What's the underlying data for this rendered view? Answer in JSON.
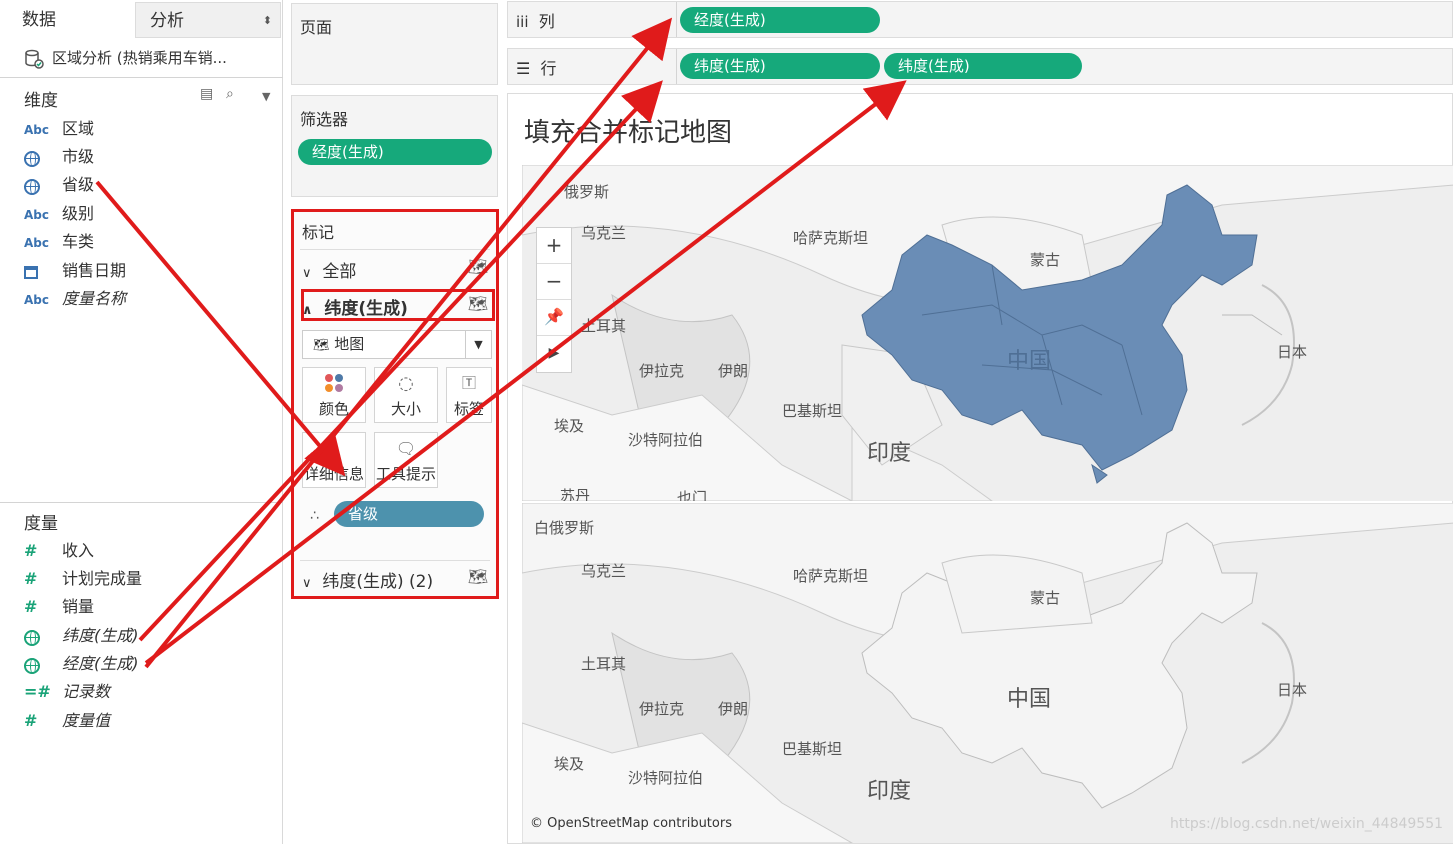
{
  "left_pane": {
    "tabs": {
      "data": "数据",
      "analysis": "分析"
    },
    "datasource": "区域分析 (热销乘用车销...",
    "dimensions_title": "维度",
    "dimensions": [
      {
        "type": "Abc",
        "label": "区域"
      },
      {
        "type": "globe",
        "label": "市级"
      },
      {
        "type": "globe",
        "label": "省级"
      },
      {
        "type": "Abc",
        "label": "级别"
      },
      {
        "type": "Abc",
        "label": "车类"
      },
      {
        "type": "calendar",
        "label": "销售日期"
      },
      {
        "type": "Abc",
        "label": "度量名称"
      }
    ],
    "measures_title": "度量",
    "measures": [
      {
        "type": "#",
        "label": "收入"
      },
      {
        "type": "#",
        "label": "计划完成量"
      },
      {
        "type": "#",
        "label": "销量"
      },
      {
        "type": "globe",
        "label": "纬度(生成)"
      },
      {
        "type": "globe",
        "label": "经度(生成)"
      },
      {
        "type": "=#",
        "label": "记录数"
      },
      {
        "type": "#",
        "label": "度量值"
      }
    ]
  },
  "pages_card": {
    "title": "页面"
  },
  "filters_card": {
    "title": "筛选器",
    "pill": "经度(生成)"
  },
  "marks_card": {
    "title": "标记",
    "all": "全部",
    "lat": "纬度(生成)",
    "mark_type": "地图",
    "buttons": {
      "color": "颜色",
      "size": "大小",
      "label": "标签",
      "detail": "详细信息",
      "tooltip": "工具提示"
    },
    "detail_pill": "省级",
    "lat2": "纬度(生成) (2)"
  },
  "shelves": {
    "columns": {
      "label": "列",
      "pills": [
        "经度(生成)"
      ]
    },
    "rows": {
      "label": "行",
      "pills": [
        "纬度(生成)",
        "纬度(生成)"
      ]
    }
  },
  "view": {
    "title": "填充合并标记地图",
    "map_labels_top": [
      "俄罗斯",
      "乌克兰",
      "哈萨克斯坦",
      "蒙古",
      "土耳其",
      "伊拉克",
      "伊朗",
      "中国",
      "日本",
      "巴基斯坦",
      "埃及",
      "沙特阿拉伯",
      "印度",
      "苏丹",
      "也门"
    ],
    "map_labels_bottom": [
      "白俄罗斯",
      "乌克兰",
      "哈萨克斯坦",
      "蒙古",
      "土耳其",
      "伊拉克",
      "伊朗",
      "中国",
      "日本",
      "巴基斯坦",
      "埃及",
      "沙特阿拉伯",
      "印度"
    ],
    "attribution": "© OpenStreetMap contributors",
    "watermark": "https://blog.csdn.net/weixin_44849551",
    "china_color": "#6a8db6"
  },
  "colors": {
    "pill_green": "#16a97b",
    "pill_blue": "#4d92ad",
    "annotation_red": "#e01b1b"
  }
}
